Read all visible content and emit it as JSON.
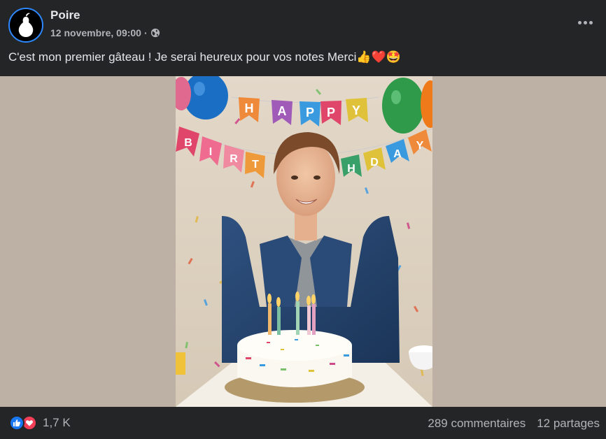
{
  "post": {
    "author": "Poire",
    "timestamp": "12 novembre, 09:00",
    "separator": "·",
    "privacy_icon": "globe-icon",
    "caption": "C'est mon premier gâteau ! Je serai heureux pour vos notes Merci👍❤️🤩",
    "photo_banner_top": "HAPPY",
    "photo_banner_bottom": "BIRTHDAY"
  },
  "footer": {
    "reaction_icons": [
      "like-icon",
      "love-icon"
    ],
    "reaction_count": "1,7 K",
    "comments": "289 commentaires",
    "shares": "12 partages"
  },
  "colors": {
    "background": "#242526",
    "text_primary": "#e4e6eb",
    "text_secondary": "#b0b3b8",
    "like_blue": "#1877f2",
    "love_red": "#f33e58",
    "photo_backdrop": "#bdb0a4"
  }
}
